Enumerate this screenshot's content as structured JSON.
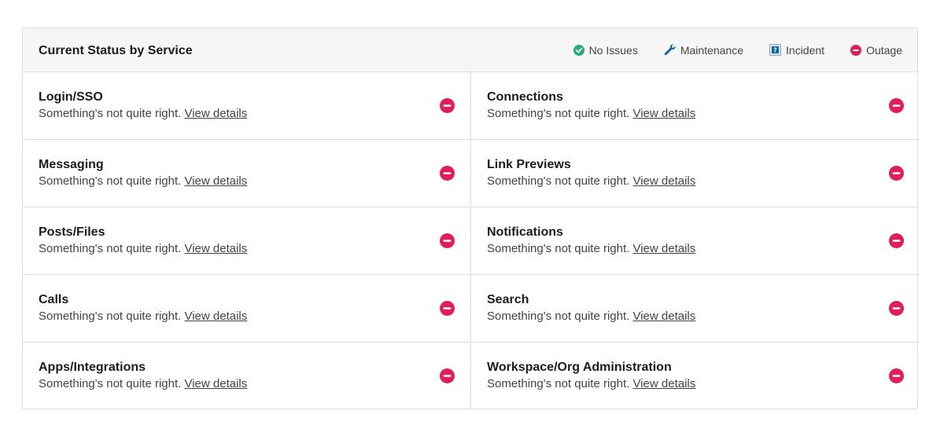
{
  "header": {
    "title": "Current Status by Service",
    "legend": [
      {
        "label": "No Issues",
        "icon": "check-circle-icon",
        "color": "#2bac76"
      },
      {
        "label": "Maintenance",
        "icon": "wrench-icon",
        "color": "#1264a3"
      },
      {
        "label": "Incident",
        "icon": "incident-icon",
        "color": "#1264a3"
      },
      {
        "label": "Outage",
        "icon": "outage-icon",
        "color": "#e01e5a"
      }
    ]
  },
  "services": [
    {
      "name": "Login/SSO",
      "message": "Something's not quite right.",
      "link": "View details",
      "status": "outage"
    },
    {
      "name": "Connections",
      "message": "Something's not quite right.",
      "link": "View details",
      "status": "outage"
    },
    {
      "name": "Messaging",
      "message": "Something's not quite right.",
      "link": "View details",
      "status": "outage"
    },
    {
      "name": "Link Previews",
      "message": "Something's not quite right.",
      "link": "View details",
      "status": "outage"
    },
    {
      "name": "Posts/Files",
      "message": "Something's not quite right.",
      "link": "View details",
      "status": "outage"
    },
    {
      "name": "Notifications",
      "message": "Something's not quite right.",
      "link": "View details",
      "status": "outage"
    },
    {
      "name": "Calls",
      "message": "Something's not quite right.",
      "link": "View details",
      "status": "outage"
    },
    {
      "name": "Search",
      "message": "Something's not quite right.",
      "link": "View details",
      "status": "outage"
    },
    {
      "name": "Apps/Integrations",
      "message": "Something's not quite right.",
      "link": "View details",
      "status": "outage"
    },
    {
      "name": "Workspace/Org Administration",
      "message": "Something's not quite right.",
      "link": "View details",
      "status": "outage"
    }
  ],
  "colors": {
    "outage": "#e01e5a",
    "no_issues": "#2bac76",
    "maintenance": "#1264a3"
  }
}
